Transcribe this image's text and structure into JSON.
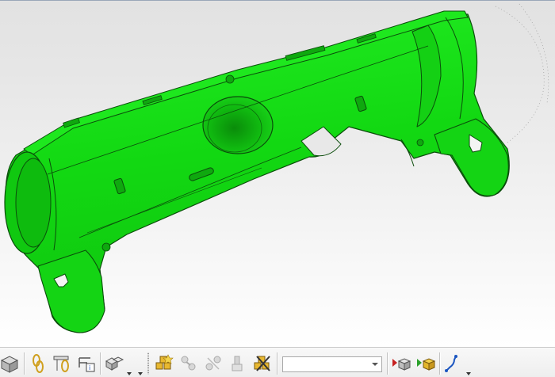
{
  "colors": {
    "part_fill": "#16e016",
    "part_edge": "#0b4d0b",
    "viewport_top": "#e2e2e2",
    "viewport_bottom": "#ffffff",
    "toolbar_bg": "#f1f1f1"
  },
  "viewport": {
    "model_name": "green-shell-part"
  },
  "toolbar": {
    "filter_select_value": "",
    "buttons": [
      {
        "icon": "view-cube-icon"
      },
      {
        "icon": "chain-link-icon"
      },
      {
        "icon": "constraint-pin-icon"
      },
      {
        "icon": "component-info-icon"
      },
      {
        "icon": "multi-cube-icon"
      },
      {
        "icon": "assembly-star-icon"
      },
      {
        "icon": "move-component-icon"
      },
      {
        "icon": "mate-assembly-icon"
      },
      {
        "icon": "insert-bolt-icon"
      },
      {
        "icon": "delete-component-icon"
      },
      {
        "icon": "play-part-icon"
      },
      {
        "icon": "play-assembly-icon"
      },
      {
        "icon": "route-curve-icon"
      }
    ]
  }
}
